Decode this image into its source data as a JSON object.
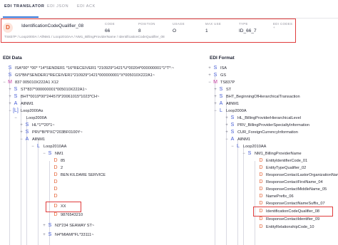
{
  "tabs": [
    {
      "label": "EDI TRANSLATOR"
    },
    {
      "label": "EDI JSON"
    },
    {
      "label": "EDI ACK"
    }
  ],
  "detail": {
    "icon_letter": "D",
    "title": "IdentificationCodeQualifier_08",
    "path": "TS837P / Loop2000A / AllNM1 / Loop2010AA / NM1_BillingProviderName / IdentificationCodeQualifier_08",
    "columns": [
      {
        "header": "CODE",
        "value": "66"
      },
      {
        "header": "POSITION",
        "value": "8"
      },
      {
        "header": "USAGE",
        "value": "O"
      },
      {
        "header": "MAX USE",
        "value": "1"
      },
      {
        "header": "TYPE",
        "value": "ID_66_7"
      },
      {
        "header": "EDI CODES +",
        "value": ""
      }
    ]
  },
  "edi_data": {
    "title": "EDI Data",
    "rows": [
      {
        "toggle": "",
        "badge": "S",
        "label": "ISA*00* *00* *14*SENDER1 *16*RECEIVER1 *210929*1421*U*00204*000000001*1*T*:~"
      },
      {
        "toggle": "",
        "badge": "S",
        "label": "GS*BN*SENDER1*RECEIVER1*210929*1421*000000001*X*005010X222A1~"
      },
      {
        "toggle": "−",
        "badge": "M",
        "label": "837 005010X222A1 X12"
      },
      {
        "toggle": "+",
        "badge": "S",
        "label": "ST*837*000000001*005010X222A1~"
      },
      {
        "toggle": "+",
        "badge": "S",
        "label": "BHT*0019*00*244579*20061015*1023*CH~"
      },
      {
        "toggle": "+",
        "badge": "A",
        "label": "AllNM1"
      },
      {
        "toggle": "−",
        "badge": "[L]",
        "label": "Loop2000As"
      },
      {
        "toggle": "−",
        "badge": "",
        "label": "Loop2000A"
      },
      {
        "toggle": "+",
        "badge": "S",
        "label": "HL*1**20*1~"
      },
      {
        "toggle": "+",
        "badge": "S",
        "label": "PRV*BI*PXC*203BF0100Y~"
      },
      {
        "toggle": "−",
        "badge": "A",
        "label": "AllNM1"
      },
      {
        "toggle": "−",
        "badge": "L",
        "label": "Loop2010AA"
      },
      {
        "toggle": "−",
        "badge": "S",
        "label": "NM1"
      },
      {
        "toggle": "",
        "badge": "D",
        "label": "85"
      },
      {
        "toggle": "",
        "badge": "D",
        "label": "2"
      },
      {
        "toggle": "",
        "badge": "D",
        "label": "BEN KILDARE SERVICE"
      },
      {
        "toggle": "",
        "badge": "D",
        "label": ""
      },
      {
        "toggle": "",
        "badge": "D",
        "label": ""
      },
      {
        "toggle": "",
        "badge": "D",
        "label": ""
      },
      {
        "toggle": "",
        "badge": "D",
        "label": "XX"
      },
      {
        "toggle": "",
        "badge": "D",
        "label": "9876543210"
      },
      {
        "toggle": "+",
        "badge": "S",
        "label": "N3*234 SEAWAY ST~"
      },
      {
        "toggle": "+",
        "badge": "S",
        "label": "N4*MIAMI*FL*33111~"
      }
    ]
  },
  "edi_format": {
    "title": "EDI Format",
    "rows": [
      {
        "toggle": "+",
        "badge": "S",
        "label": "ISA"
      },
      {
        "toggle": "+",
        "badge": "S",
        "label": "GS"
      },
      {
        "toggle": "−",
        "badge": "M",
        "label": "TS837P"
      },
      {
        "toggle": "+",
        "badge": "S",
        "label": "ST"
      },
      {
        "toggle": "+",
        "badge": "S",
        "label": "BHT_BeginningOfHierarchicalTransaction"
      },
      {
        "toggle": "+",
        "badge": "A",
        "label": "AllNM1"
      },
      {
        "toggle": "−",
        "badge": "L",
        "label": "Loop2000A"
      },
      {
        "toggle": "+",
        "badge": "S",
        "label": "HL_BillingProviderHierarchicalLevel"
      },
      {
        "toggle": "+",
        "badge": "S",
        "label": "PRV_BillingProviderSpecialtyInformation"
      },
      {
        "toggle": "+",
        "badge": "S",
        "label": "CUR_ForeignCurrencyInformation"
      },
      {
        "toggle": "−",
        "badge": "A",
        "label": "AllNM1"
      },
      {
        "toggle": "−",
        "badge": "L",
        "label": "Loop2010AA"
      },
      {
        "toggle": "−",
        "badge": "S",
        "label": "NM1_BillingProviderName"
      },
      {
        "toggle": "",
        "badge": "D",
        "label": "EntityIdentifierCode_01"
      },
      {
        "toggle": "",
        "badge": "D",
        "label": "EntityTypeQualifier_02"
      },
      {
        "toggle": "",
        "badge": "D",
        "label": "ResponseContactLastorOrganizationName_03"
      },
      {
        "toggle": "",
        "badge": "D",
        "label": "ResponseContactFirstName_04"
      },
      {
        "toggle": "",
        "badge": "D",
        "label": "ResponseContactMiddleName_05"
      },
      {
        "toggle": "",
        "badge": "D",
        "label": "NamePrefix_06"
      },
      {
        "toggle": "",
        "badge": "D",
        "label": "ResponseContactNameSuffix_07"
      },
      {
        "toggle": "",
        "badge": "D",
        "label": "IdentificationCodeQualifier_08"
      },
      {
        "toggle": "",
        "badge": "D",
        "label": "ResponseContactIdentifier_09"
      },
      {
        "toggle": "",
        "badge": "D",
        "label": "EntityRelationshipCode_10"
      }
    ]
  }
}
